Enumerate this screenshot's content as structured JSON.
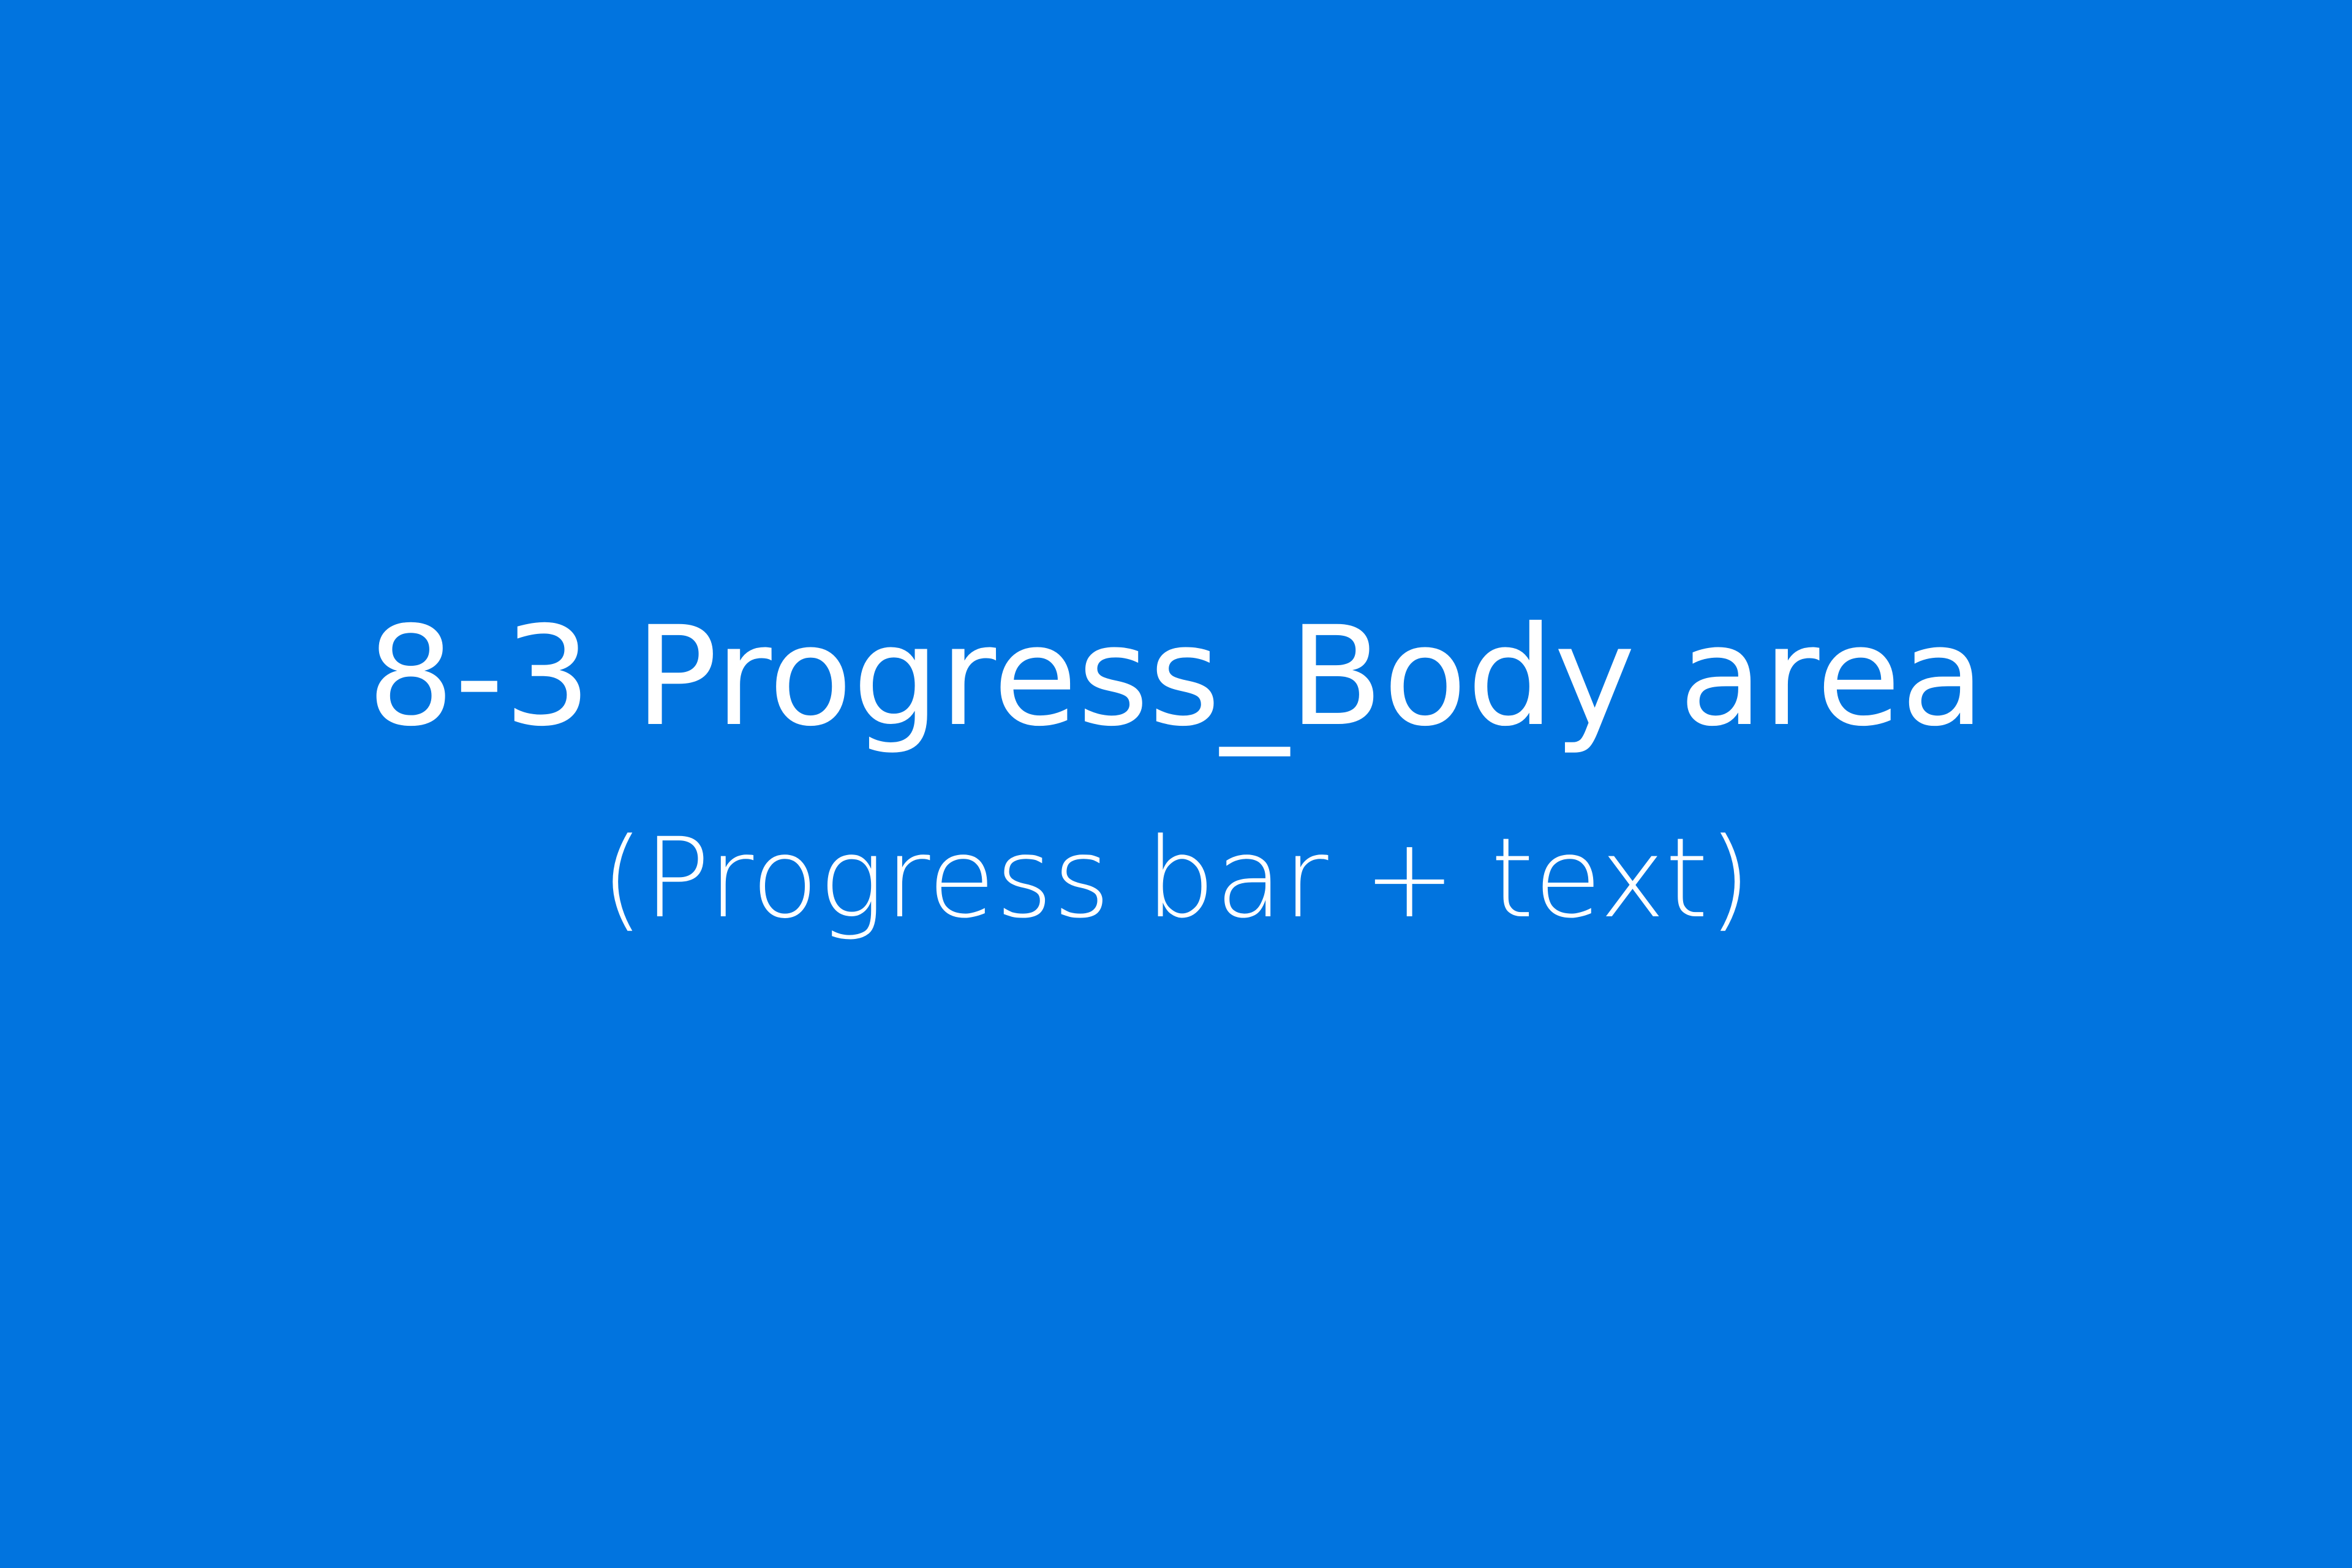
{
  "slide": {
    "title": "8-3 Progress_Body area",
    "subtitle": "(Progress bar + text)",
    "background_color": "#0174df",
    "text_color": "#ffffff"
  }
}
